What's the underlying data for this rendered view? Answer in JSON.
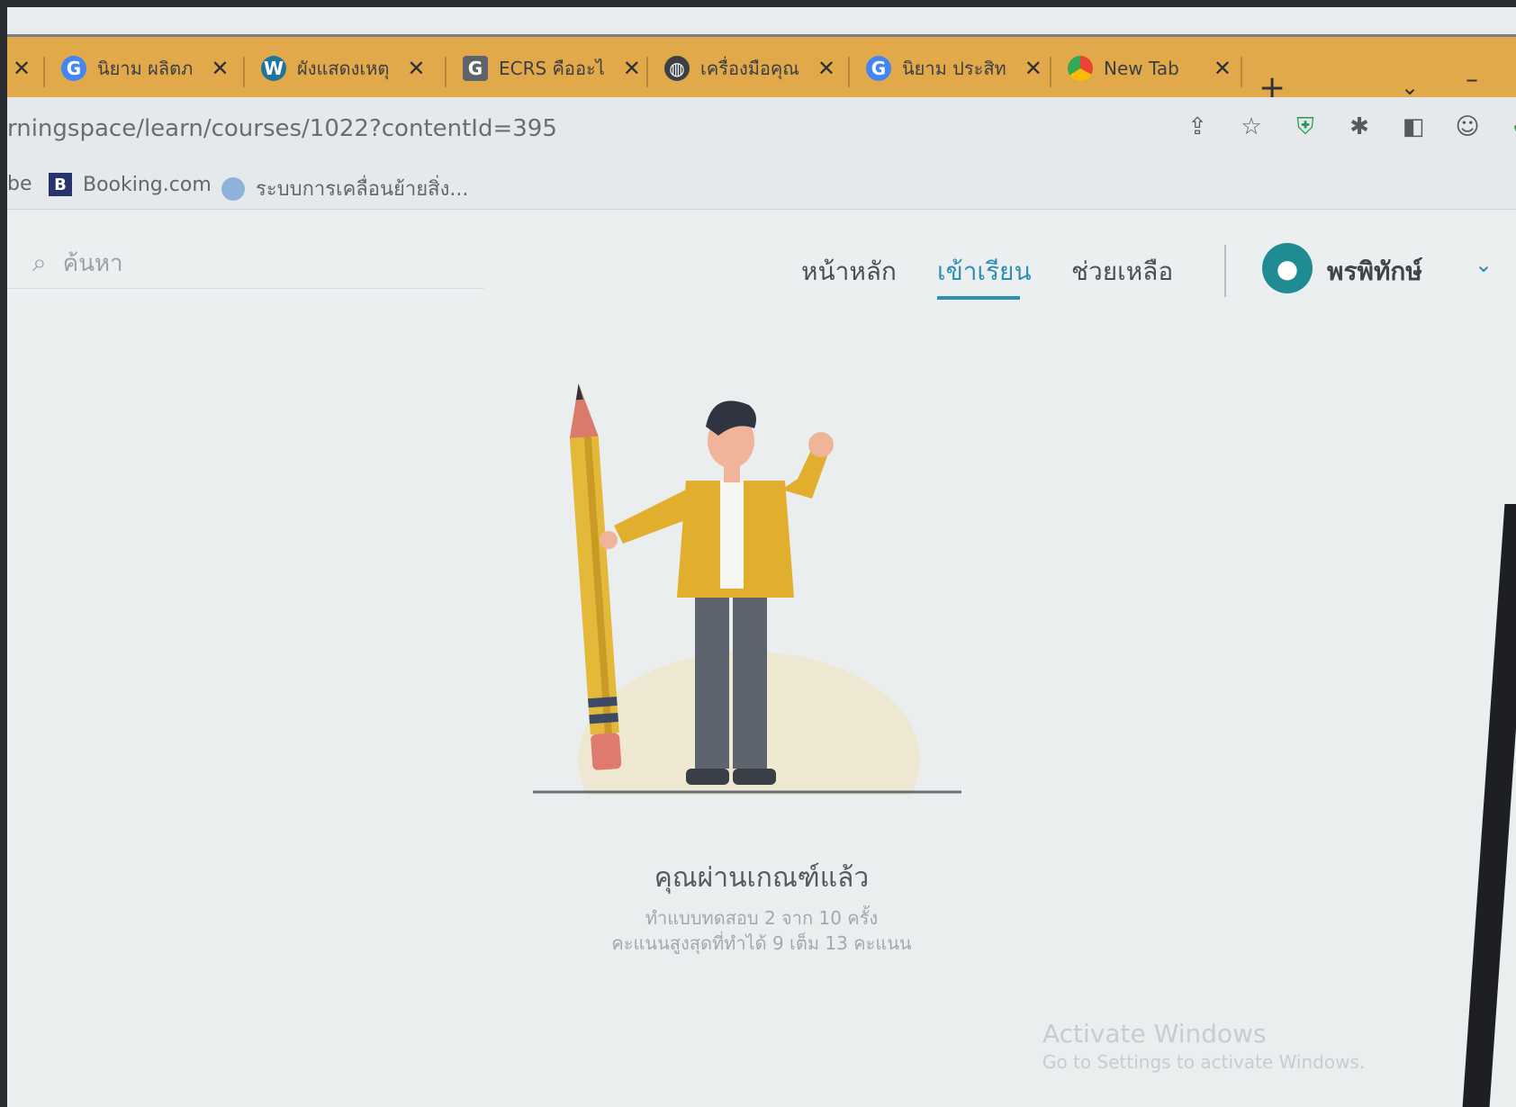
{
  "browser": {
    "tabs": [
      {
        "title": "นิยาม ผลิตภ",
        "favicon": "G"
      },
      {
        "title": "ผังแสดงเหตุ",
        "favicon": "W"
      },
      {
        "title": "ECRS คืออะไ",
        "favicon": "G"
      },
      {
        "title": "เครื่องมือคุณ",
        "favicon": "globe"
      },
      {
        "title": "นิยาม ประสิท",
        "favicon": "G"
      },
      {
        "title": "New Tab",
        "favicon": "chrome"
      }
    ],
    "new_tab": "+",
    "url": "rningspace/learn/courses/1022?contentId=395",
    "bookmarks": [
      {
        "label": "be"
      },
      {
        "label": "Booking.com",
        "icon": "B"
      },
      {
        "label": "ระบบการเคลื่อนย้ายสิ่ง..."
      }
    ]
  },
  "site": {
    "search_placeholder": "ค้นหา",
    "nav": [
      {
        "label": "หน้าหลัก",
        "active": false
      },
      {
        "label": "เข้าเรียน",
        "active": true
      },
      {
        "label": "ช่วยเหลือ",
        "active": false
      }
    ],
    "user_name": "พรพิทักษ์"
  },
  "result": {
    "title": "คุณผ่านเกณฑ์แล้ว",
    "attempts": "ทำแบบทดสอบ 2 จาก 10 ครั้ง",
    "best_score": "คะแนนสูงสุดที่ทำได้ 9 เต็ม 13 คะแนน"
  },
  "os": {
    "activate_title": "Activate Windows",
    "activate_sub": "Go to Settings to activate Windows."
  },
  "colors": {
    "tab_strip": "#e1a94a",
    "accent": "#2f8fb0",
    "avatar": "#1f8b93"
  }
}
